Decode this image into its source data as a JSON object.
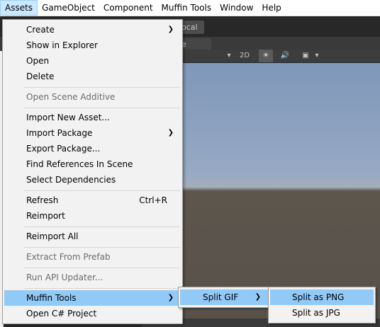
{
  "menubar": {
    "items": [
      "Assets",
      "GameObject",
      "Component",
      "Muffin Tools",
      "Window",
      "Help"
    ]
  },
  "scene": {
    "local_label": "ocal",
    "tab_label": "e",
    "toolbar": {
      "mode_2d": "2D",
      "sun_icon": "☀",
      "audio_icon": "🔊",
      "fx_icon": "▣",
      "caret": "▾"
    }
  },
  "assets_menu": {
    "items": [
      {
        "label": "Create",
        "submenu": true
      },
      {
        "label": "Show in Explorer"
      },
      {
        "label": "Open"
      },
      {
        "label": "Delete"
      },
      {
        "label": "Open Scene Additive",
        "disabled": true
      },
      {
        "label": "Import New Asset..."
      },
      {
        "label": "Import Package",
        "submenu": true
      },
      {
        "label": "Export Package..."
      },
      {
        "label": "Find References In Scene"
      },
      {
        "label": "Select Dependencies"
      },
      {
        "label": "Refresh",
        "shortcut": "Ctrl+R"
      },
      {
        "label": "Reimport"
      },
      {
        "label": "Reimport All"
      },
      {
        "label": "Extract From Prefab",
        "disabled": true
      },
      {
        "label": "Run API Updater...",
        "disabled": true
      },
      {
        "label": "Muffin Tools",
        "submenu": true,
        "highlighted": true
      },
      {
        "label": "Open C# Project"
      }
    ]
  },
  "muffin_submenu": {
    "items": [
      {
        "label": "Split GIF",
        "submenu": true,
        "highlighted": true
      }
    ]
  },
  "split_gif_submenu": {
    "items": [
      {
        "label": "Split as PNG",
        "highlighted": true
      },
      {
        "label": "Split as JPG"
      }
    ]
  },
  "colors": {
    "highlight": "#91c9f7",
    "menu_bg": "#f2f2f2",
    "menubar_active": "#cce8ff"
  }
}
